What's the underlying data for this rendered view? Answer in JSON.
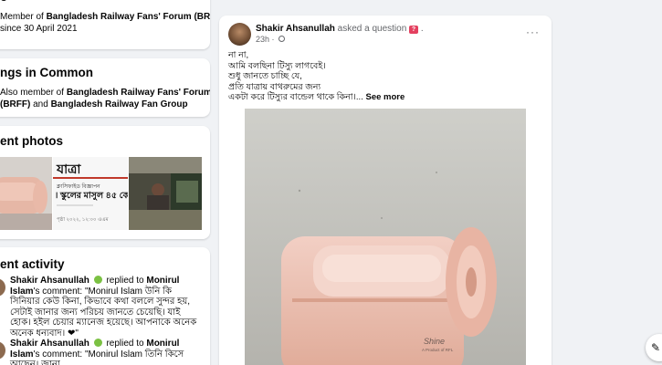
{
  "about": {
    "title_fragment": "o",
    "line1_prefix": "Member of ",
    "line1_group": "Bangladesh Railway Fans' Forum (BRFF)",
    "line2": "since 30 April 2021"
  },
  "common": {
    "title": "ngs in Common",
    "line1_prefix": "Also member of ",
    "line1_group": "Bangladesh Railway Fans' Forum",
    "line2_group1": "(BRFF)",
    "line2_and": " and ",
    "line2_group2": "Bangladesh Railway Fan Group"
  },
  "photos": {
    "title": "ent photos",
    "newspaper_masthead": "যাত্রা",
    "newspaper_line1": "ক্লাসিফাইড বিজ্ঞাপন",
    "newspaper_headline": "। স্কুলের মাসুল ৪৫ কোটি",
    "newspaper_small": "পৃষ্ঠা ২০২২, ১২:০০ এএম"
  },
  "activity": {
    "title": "ent activity",
    "items": [
      {
        "name": "Shakir Ahsanullah",
        "verb": "replied to",
        "target": "Monirul Islam",
        "suffix": "'s",
        "comment": "comment: \"Monirul Islam উনি কি সিনিয়ার কেউ কিনা, কিভাবে কথা বললে সুন্দর হয়, সেটাই জানার জন্য পরিচয় জানতে চেয়েছি। যাই হোক। হইল চেয়ার ম্যানেজ হয়েছে। আপনাকে অনেক অনেক ধন্যবাদ। ❤\""
      },
      {
        "name": "Shakir Ahsanullah",
        "verb": "replied to",
        "target": "Monirul Islam",
        "suffix": "'s",
        "comment": "comment: \"Monirul Islam তিনি কিসে আছেন। জানা"
      }
    ]
  },
  "post": {
    "author": "Shakir Ahsanullah",
    "action": "asked a question",
    "badge": "?",
    "dot": ".",
    "time": "23h",
    "time_sep": " · ",
    "more": "···",
    "lines": [
      "না না,",
      "আমি বলছিনা টিস্যু লাগবেই।",
      "শুধু জানতে চাচ্ছি যে,",
      "প্রতি যাত্রায় বাথরুমের জন্য",
      "একটা করে টিস্যুর বান্ডেল থাকে কিনা।..."
    ],
    "see_more": "See more",
    "image_brand": "Shine",
    "image_brand_sub": "A Product of RFL"
  },
  "floating": {
    "icon": "edit-icon",
    "glyph": "✎"
  }
}
